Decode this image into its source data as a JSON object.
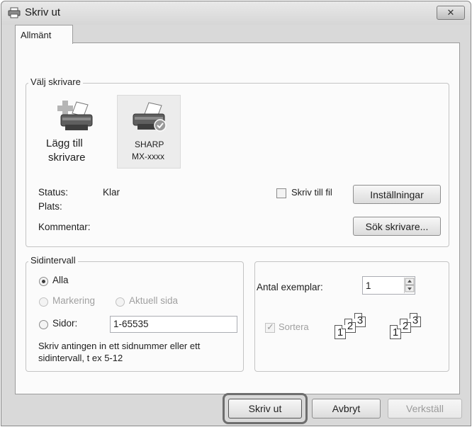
{
  "window": {
    "title": "Skriv ut",
    "close_label": "✕"
  },
  "tabs": [
    {
      "label": "Allmänt"
    }
  ],
  "select_printer": {
    "legend": "Välj skrivare",
    "add_printer_line1": "Lägg till",
    "add_printer_line2": "skrivare",
    "printer_name_line1": "SHARP",
    "printer_name_line2": "MX-xxxx"
  },
  "info": {
    "status_label": "Status:",
    "status_value": "Klar",
    "location_label": "Plats:",
    "comment_label": "Kommentar:",
    "print_to_file_label": "Skriv till fil",
    "preferences_button": "Inställningar",
    "find_printer_button": "Sök skrivare..."
  },
  "page_range": {
    "legend": "Sidintervall",
    "all_label": "Alla",
    "selection_label": "Markering",
    "current_page_label": "Aktuell sida",
    "pages_label": "Sidor:",
    "pages_value": "1-65535",
    "hint_line1": "Skriv antingen in ett sidnummer eller ett",
    "hint_line2": "sidintervall, t ex 5-12"
  },
  "copies": {
    "label": "Antal exemplar:",
    "value": "1",
    "collate_label": "Sortera",
    "collate_pages": [
      "1",
      "2",
      "3"
    ]
  },
  "footer": {
    "print_button": "Skriv ut",
    "cancel_button": "Avbryt",
    "apply_button": "Verkställ"
  },
  "colors": {
    "highlight_border": "#6e6e6e",
    "dialog_background": "#d9d9d9",
    "panel_background": "#fbfbfb"
  }
}
